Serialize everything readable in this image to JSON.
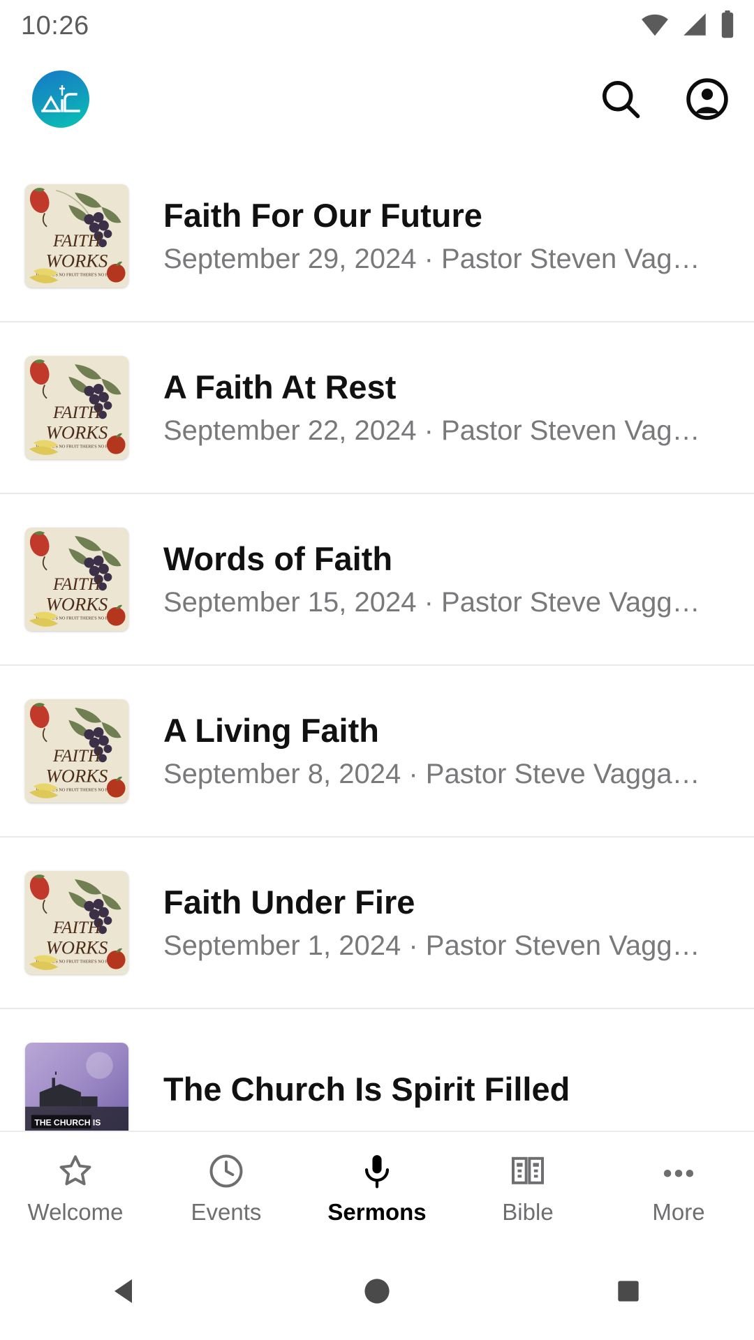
{
  "status_bar": {
    "time": "10:26",
    "icons": [
      "wifi-icon",
      "cellular-signal-icon",
      "battery-icon"
    ]
  },
  "app_bar": {
    "logo_name": "church-app-logo",
    "logo_colors": {
      "from": "#1679c8",
      "to": "#07c5b4"
    },
    "actions": [
      {
        "name": "search-icon",
        "label": "Search"
      },
      {
        "name": "account-icon",
        "label": "Account"
      }
    ]
  },
  "sermons": [
    {
      "title": "Faith For Our Future",
      "subtitle": "September 29, 2024 · Pastor Steven Vag…",
      "thumbnail": "faith-works-artwork"
    },
    {
      "title": "A Faith At Rest",
      "subtitle": "September 22, 2024 · Pastor Steven Vag…",
      "thumbnail": "faith-works-artwork"
    },
    {
      "title": "Words of Faith",
      "subtitle": "September 15, 2024 · Pastor Steve Vagg…",
      "thumbnail": "faith-works-artwork"
    },
    {
      "title": "A Living Faith",
      "subtitle": "September 8, 2024 · Pastor Steve Vagga…",
      "thumbnail": "faith-works-artwork"
    },
    {
      "title": "Faith Under Fire",
      "subtitle": "September 1, 2024 · Pastor Steven Vagg…",
      "thumbnail": "faith-works-artwork"
    },
    {
      "title": "The Church Is Spirit Filled",
      "subtitle": "",
      "thumbnail": "the-church-is-artwork",
      "thumbnail_caption": "THE CHURCH IS"
    }
  ],
  "thumbnail_art": {
    "faith_works": {
      "background": "#ece5d2",
      "title_line1": "FAITH",
      "title_line2": "WORKS",
      "tagline": "IF THERE'S NO FRUIT THERE'S NO FAITH"
    },
    "church_is": {
      "caption": "THE CHURCH IS"
    }
  },
  "bottom_nav": {
    "active": "Sermons",
    "items": [
      {
        "label": "Welcome",
        "icon": "star-icon"
      },
      {
        "label": "Events",
        "icon": "clock-icon"
      },
      {
        "label": "Sermons",
        "icon": "microphone-icon"
      },
      {
        "label": "Bible",
        "icon": "open-book-icon"
      },
      {
        "label": "More",
        "icon": "more-dots-icon"
      }
    ]
  },
  "system_nav": {
    "items": [
      {
        "name": "back-button",
        "icon": "triangle-back-icon"
      },
      {
        "name": "home-button",
        "icon": "circle-home-icon"
      },
      {
        "name": "recents-button",
        "icon": "square-recents-icon"
      }
    ]
  }
}
